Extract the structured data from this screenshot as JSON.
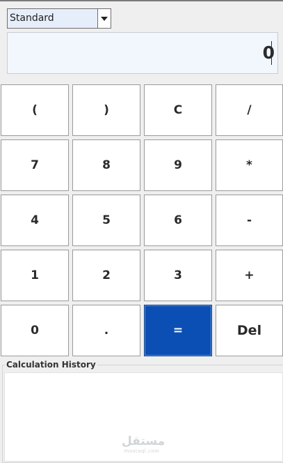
{
  "mode_select": {
    "selected": "Standard"
  },
  "display": {
    "value": "0"
  },
  "keypad": {
    "rows": [
      [
        {
          "label": "(",
          "name": "open-paren"
        },
        {
          "label": ")",
          "name": "close-paren"
        },
        {
          "label": "C",
          "name": "clear"
        },
        {
          "label": "/",
          "name": "divide"
        }
      ],
      [
        {
          "label": "7",
          "name": "digit-7"
        },
        {
          "label": "8",
          "name": "digit-8"
        },
        {
          "label": "9",
          "name": "digit-9"
        },
        {
          "label": "*",
          "name": "multiply"
        }
      ],
      [
        {
          "label": "4",
          "name": "digit-4"
        },
        {
          "label": "5",
          "name": "digit-5"
        },
        {
          "label": "6",
          "name": "digit-6"
        },
        {
          "label": "-",
          "name": "subtract"
        }
      ],
      [
        {
          "label": "1",
          "name": "digit-1"
        },
        {
          "label": "2",
          "name": "digit-2"
        },
        {
          "label": "3",
          "name": "digit-3"
        },
        {
          "label": "+",
          "name": "add"
        }
      ],
      [
        {
          "label": "0",
          "name": "digit-0"
        },
        {
          "label": ".",
          "name": "decimal"
        },
        {
          "label": "=",
          "name": "equals"
        },
        {
          "label": "Del",
          "name": "delete"
        }
      ]
    ]
  },
  "history": {
    "title": "Calculation History"
  },
  "watermark": {
    "glyph": "مستقل",
    "text": "mostaql.com"
  },
  "colors": {
    "equals_bg": "#0b4fb4",
    "display_bg": "#f2f6fd",
    "select_bg": "#e6eefb"
  }
}
